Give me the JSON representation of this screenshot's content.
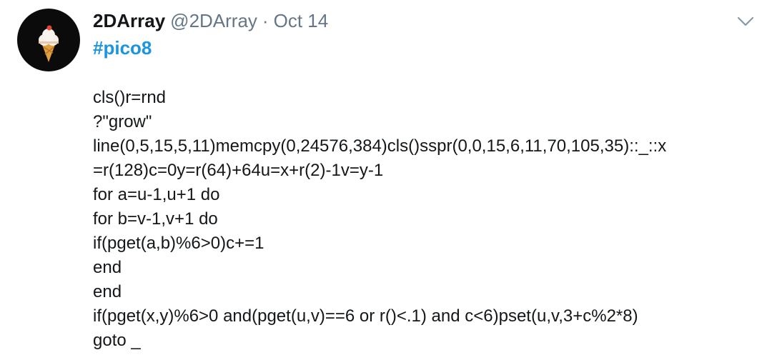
{
  "tweet": {
    "display_name": "2DArray",
    "handle": "@2DArray",
    "separator": "·",
    "date": "Oct 14",
    "hashtag": "#pico8",
    "avatar_icon": "ice-cream-icon",
    "menu_icon": "chevron-down-icon",
    "code_lines": [
      "cls()r=rnd",
      "?\"grow\"",
      "line(0,5,15,5,11)memcpy(0,24576,384)cls()sspr(0,0,15,6,11,70,105,35)::_::x",
      "=r(128)c=0y=r(64)+64u=x+r(2)-1v=y-1",
      "for a=u-1,u+1 do",
      "for b=v-1,v+1 do",
      "if(pget(a,b)%6>0)c+=1",
      "end",
      "end",
      "if(pget(x,y)%6>0 and(pget(u,v)==6 or r()<.1) and c<6)pset(u,v,3+c%2*8)",
      "goto _"
    ]
  },
  "colors": {
    "text": "#14171a",
    "muted": "#657786",
    "link": "#1b95e0",
    "avatar_bg": "#0b0b0b"
  }
}
